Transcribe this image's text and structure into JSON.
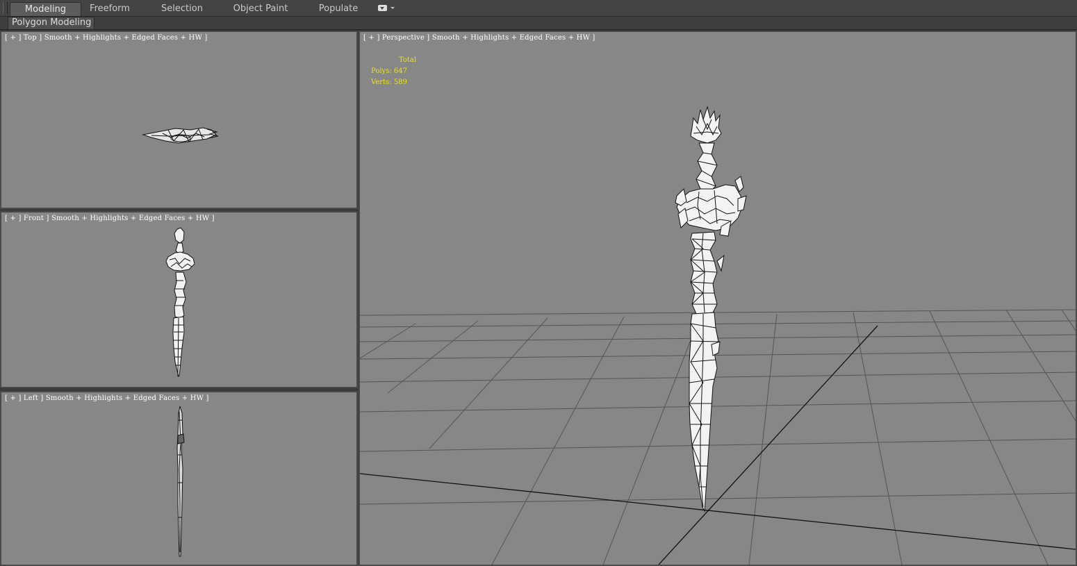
{
  "ribbon": {
    "tabs": [
      "Modeling",
      "Freeform",
      "Selection",
      "Object Paint",
      "Populate"
    ],
    "active_tab": "Modeling",
    "panel_label": "Polygon Modeling"
  },
  "viewports": {
    "top": {
      "label": "[ + ] Top ] Smooth + Highlights + Edged Faces + HW ]"
    },
    "front": {
      "label": "[ + ] Front ] Smooth + Highlights + Edged Faces + HW ]"
    },
    "left": {
      "label": "[ + ] Left ] Smooth + Highlights + Edged Faces + HW ]"
    },
    "perspective": {
      "label": "[ + ] Perspective ] Smooth + Highlights + Edged Faces + HW ]",
      "stats": {
        "header": "Total",
        "polys_label": "Polys:",
        "polys_value": "647",
        "verts_label": "Verts:",
        "verts_value": "589"
      }
    }
  },
  "colors": {
    "viewport_bg": "#878787",
    "stats_text": "#f2e31a",
    "label_text": "#ffffff",
    "ui_dark": "#444444"
  }
}
